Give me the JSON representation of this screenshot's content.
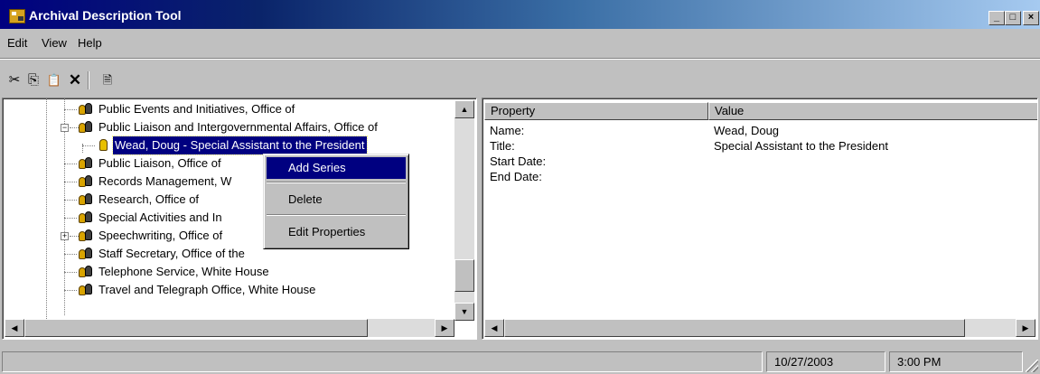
{
  "window": {
    "title": "Archival Description Tool",
    "controls": {
      "minimize": "_",
      "maximize": "□",
      "close": "×"
    }
  },
  "menubar": {
    "items": [
      "Edit",
      "View",
      "Help"
    ]
  },
  "toolbar": {
    "buttons": [
      {
        "name": "cut",
        "icon": "scissors-icon",
        "glyph": "✂"
      },
      {
        "name": "copy",
        "icon": "copy-icon",
        "glyph": "⎘"
      },
      {
        "name": "paste",
        "icon": "paste-icon",
        "glyph": "📋"
      },
      {
        "name": "delete",
        "icon": "delete-x-icon",
        "glyph": "✕"
      },
      {
        "name": "properties",
        "icon": "properties-icon",
        "glyph": "🗎"
      }
    ]
  },
  "tree": {
    "items": [
      {
        "label": "Public Events and Initiatives, Office of"
      },
      {
        "label": "Public Liaison and Intergovernmental Affairs, Office of",
        "expanded": true
      },
      {
        "label": "Wead, Doug - Special Assistant to the President",
        "selected": true
      },
      {
        "label": "Public Liaison, Office of"
      },
      {
        "label": "Records Management, W"
      },
      {
        "label": "Research, Office of"
      },
      {
        "label": "Special Activities and In"
      },
      {
        "label": "Speechwriting, Office of",
        "collapsed": true
      },
      {
        "label": "Staff Secretary, Office of the"
      },
      {
        "label": "Telephone Service, White House"
      },
      {
        "label": "Travel and Telegraph Office, White House"
      }
    ]
  },
  "context_menu": {
    "items": [
      "Add Series",
      "Delete",
      "Edit Properties"
    ],
    "highlighted": "Add Series"
  },
  "properties": {
    "columns": [
      "Property",
      "Value"
    ],
    "rows": [
      [
        "Name:",
        "Wead, Doug"
      ],
      [
        "Title:",
        "Special Assistant to the President"
      ],
      [
        "Start Date:",
        ""
      ],
      [
        "End Date:",
        ""
      ]
    ]
  },
  "statusbar": {
    "message": "",
    "date": "10/27/2003",
    "time": "3:00 PM"
  }
}
